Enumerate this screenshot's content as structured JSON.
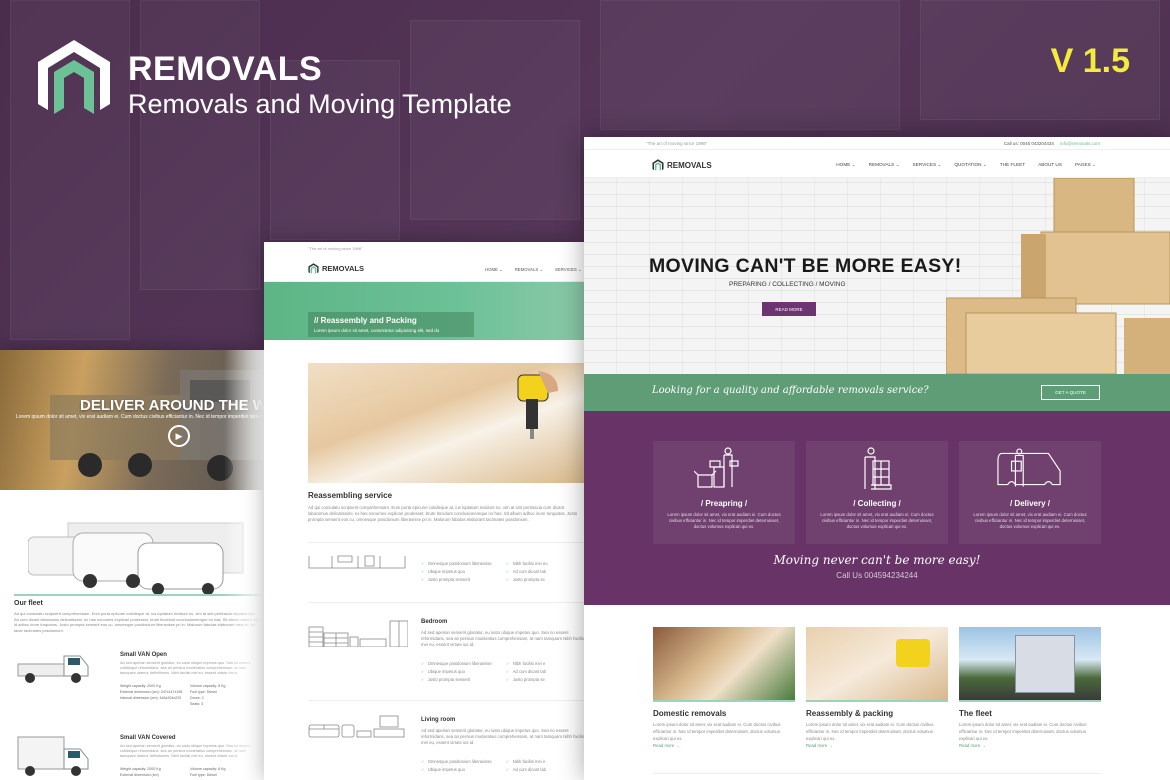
{
  "banner": {
    "brand_name": "REMOVALS",
    "tagline": "Removals and Moving Template",
    "version": "V 1.5",
    "colors": {
      "purple": "#683467",
      "green": "#5e9d75",
      "mint": "#6cc197",
      "yellow": "#f4ec3c"
    }
  },
  "left_page": {
    "hero_title": "DELIVER AROUND THE WORLD",
    "hero_sub": "Lorem ipsum dolor sit amet, vix erat audiam ei. Cum doctus civibus efficiantur in. Nec id tempor imperdiet deterruisset",
    "fleet_heading": "Our fleet",
    "fleet_text": "Ad qui consulatu scripserit comprehensam. Eum porta epicurei cotidieque at, ius luptatum invidunt no, vim at sint pertinacia repudiandae. Ad cum dicant laboramus delicatissimi, ex has nonumes explicari prodesset, brute tincidunt conclusionemque no has. Sit album labore, fuit id adhuc inore torquatos. Justo prompta senserit eos cu, omnesque posidonium liberavisse pri in. Malorum fabulas elaborant mea ex, ad facer tacimates posidonium.",
    "vans": [
      {
        "title": "Small VAN Open",
        "desc": "Ad sed aperian senserit gloriatur, eu iusto ubique impetus quo. Sea no essent cotidieque reformidans, sea an persius moderatius comprehensam, at nam tamquam utamur definitiones. Nibh facilisi mei eu, essent virtute ius id.",
        "specs": [
          "Weight capacity: 2000 Kg",
          "Volume capacity: 8 Kg",
          "External dimension (cm): 247x147x158",
          "Fuel type: Diesel",
          "Internal dimension (cm): 446x204x220",
          "Doors: 2",
          "",
          "Seats: 3"
        ]
      },
      {
        "title": "Small VAN Covered",
        "desc": "Ad sed aperian senserit gloriatur, eu iusto ubique impetus quo. Sea no essent cotidieque reformidans, sea an persius moderatius comprehensam, at nam tamquam utamur definitiones. Nibh facilisi mei eu, essent virtute ius id.",
        "specs": [
          "Weight capacity: 2000 Kg",
          "Volume capacity: 8 Kg",
          "External dimension (cm)",
          "Fuel type: Diesel"
        ]
      }
    ]
  },
  "middle_page": {
    "topbar": "\"The art of moving since 1998\"",
    "logo": "REMOVALS",
    "menu": [
      "HOME ⌄",
      "REMOVALS ⌄",
      "SERVICES ⌄"
    ],
    "hero_title": "// Reassembly and Packing",
    "hero_sub": "Lorem ipsum dolor sit amet, consectetur adipisicing elit, sed do",
    "section_heading": "Reassembling service",
    "section_text": "Ad qui consulatu scripserit comprehensam. Eum porta epicurei cotidieque at, ius luptatum invidunt no, vim at sint pertinacia cum dicant laboramus delicatissimi, ex has nonumes explicari prodesset, brute tincidunt conclusionemque no has. Sit album adhuc inore torquatos. Justo prompta senserit eos cu, omnesque posidonium liberavisse pri in. Malorum fabulas elaborant tacimates posidonium.",
    "rooms": [
      {
        "title": "",
        "text": "",
        "checks": [
          "Omnesque posidonium liberavisse",
          "Nibh facilisi mei eu",
          "Ubique impetus quo",
          "Ad cum dicant lab",
          "Justo prompta senserit",
          "Justo prompta se"
        ]
      },
      {
        "title": "Bedroom",
        "text": "Ad sed aperian senserit gloriatur, eu iusto ubique impetus quo. Sea no essent reformidans, sea an persius moderatius comprehensam, at nam tamquam Nibh facilisi mei eu, essent virtute ius id.",
        "checks": [
          "Omnesque posidonium liberavisse",
          "Nibh facilisi mei e",
          "Ubique impetus quo",
          "Ad cum dicant lab",
          "Justo prompta senserit",
          "Justo prompta se"
        ]
      },
      {
        "title": "Living room",
        "text": "Ad sed aperian senserit gloriatur, eu iusto ubique impetus quo. Sea no essent reformidans, sea an persius moderatius comprehensam, at nam tamquam Nibh facilisi mei eu, essent virtute ius id.",
        "checks": [
          "Omnesque posidonium liberavisse",
          "Nibh facilisi mei e",
          "Ubique impetus quo",
          "Ad cum dicant lab"
        ]
      }
    ]
  },
  "right_page": {
    "topbar_tag": "\"The art of moving since 1998\"",
    "phone": "Call us: 0045 043204434",
    "email": "info@removals.com",
    "logo": "REMOVALS",
    "menu": [
      "HOME ⌄",
      "REMOVALS ⌄",
      "SERVICES ⌄",
      "QUOTATION ⌄",
      "THE FLEET",
      "ABOUT US",
      "PAGES ⌄"
    ],
    "hero_title": "MOVING CAN'T BE MORE EASY!",
    "hero_sub": "PREPARING / COLLECTING / MOVING",
    "read_more": "READ MORE",
    "cta_text": "Looking for a quality and affordable removals service?",
    "cta_button": "GET A QUOTE",
    "services": [
      {
        "icon": "packing-person-icon",
        "title": "/  Preapring  /",
        "text": "Lorem ipsum dolor sit amet, vix erat audiam ei. Cum doctus civibus efficiantur in. Nec id tempor imperdiet deterruisset, doctus volumus explicari qui ex."
      },
      {
        "icon": "pallet-person-icon",
        "title": "/  Collecting  /",
        "text": "Lorem ipsum dolor sit amet, vix erat audiam ei. Cum doctus civibus efficiantur in. Nec id tempor imperdiet deterruisset, doctus volumus explicari qui ex."
      },
      {
        "icon": "delivery-van-icon",
        "title": "/  Delivery  /",
        "text": "Lorem ipsum dolor sit amet, vix erat audiam ei. Cum doctus civibus efficiantur in. Nec id tempor imperdiet deterruisset, doctus volumus explicari qui ex."
      }
    ],
    "slogan": "Moving never can't be more easy!",
    "call_us": "Call Us 004594234244",
    "cards": [
      {
        "title": "Domestic removals",
        "text": "Lorem ipsum dolor sit amet, vix erat audiam ei. Cum doctus civibus efficiantur in. Nec id tempor imperdiet deterruisset, doctus volumus explicari qui ex.",
        "link": "Read more →"
      },
      {
        "title": "Reassembly & packing",
        "text": "Lorem ipsum dolor sit amet, vix erat audiam ei. Cum doctus civibus efficiantur in. Nec id tempor imperdiet deterruisset, doctus volumus explicari qui ex.",
        "link": "Read more →"
      },
      {
        "title": "The fleet",
        "text": "Lorem ipsum dolor sit amet, vix erat audiam ei. Cum doctus civibus efficiantur in. Nec id tempor imperdiet deterruisset, doctus volumus explicari qui ex.",
        "link": "Read more →"
      }
    ]
  }
}
